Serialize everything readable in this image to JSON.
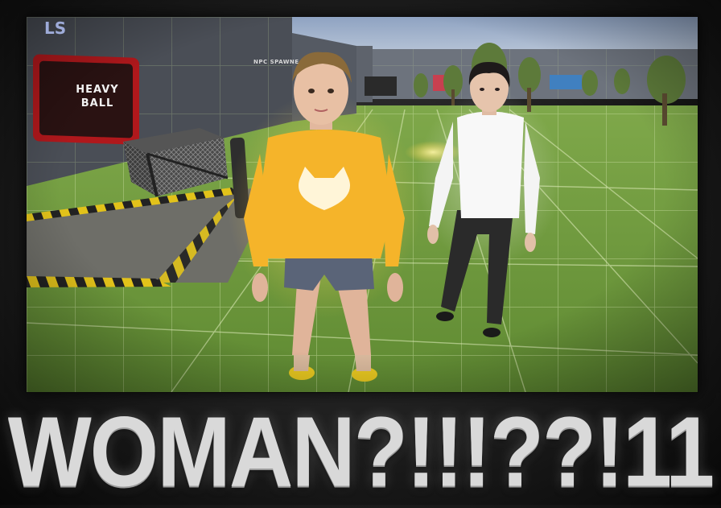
{
  "scene": {
    "sign_label": "HEAVY\nBALL",
    "npc_spawner_label": "NPC SPAWNE",
    "wall_glyphs": "LS"
  },
  "characters": [
    {
      "outfit": "yellow-sweater-with-cat-face",
      "color": "#f5b42a"
    },
    {
      "outfit": "white-top-black-pants",
      "color": "#f4f4f4"
    }
  ],
  "caption": {
    "text": "WOMAN?!!!??!11"
  },
  "colors": {
    "sign_frame": "#c81e1e",
    "ground": "#6f9a3c",
    "sky": "#b8c6d8",
    "caption": "#d9d9d9"
  }
}
